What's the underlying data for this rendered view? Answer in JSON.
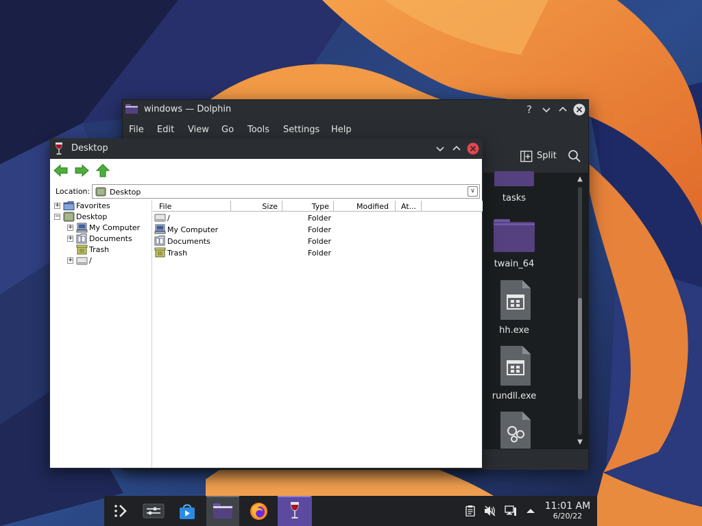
{
  "dolphin": {
    "title": "windows — Dolphin",
    "menu": [
      "File",
      "Edit",
      "View",
      "Go",
      "Tools",
      "Settings",
      "Help"
    ],
    "split_label": "Split",
    "files": [
      {
        "name": "tasks",
        "icon": "folder-icon"
      },
      {
        "name": "twain_64",
        "icon": "folder-icon"
      },
      {
        "name": "hh.exe",
        "icon": "executable-icon"
      },
      {
        "name": "rundll.exe",
        "icon": "executable-icon"
      },
      {
        "name": "",
        "icon": "settings-file-icon"
      }
    ]
  },
  "wine": {
    "title": "Desktop",
    "location_label": "Location:",
    "location_value": "Desktop",
    "tree": [
      {
        "label": "Favorites",
        "expander": "+",
        "icon": "favorites-folder-icon"
      },
      {
        "label": "Desktop",
        "expander": "−",
        "icon": "desktop-icon"
      },
      {
        "label": "My Computer",
        "expander": "+",
        "icon": "computer-icon"
      },
      {
        "label": "Documents",
        "expander": "+",
        "icon": "documents-icon"
      },
      {
        "label": "Trash",
        "expander": "",
        "icon": "trash-icon"
      },
      {
        "label": "/",
        "expander": "+",
        "icon": "drive-icon"
      }
    ],
    "columns": [
      "File",
      "Size",
      "Type",
      "Modified",
      "At..."
    ],
    "rows": [
      {
        "name": "/",
        "type": "Folder",
        "icon": "drive-icon"
      },
      {
        "name": "My Computer",
        "type": "Folder",
        "icon": "computer-icon"
      },
      {
        "name": "Documents",
        "type": "Folder",
        "icon": "documents-icon"
      },
      {
        "name": "Trash",
        "type": "Folder",
        "icon": "trash-icon"
      }
    ]
  },
  "taskbar": {
    "apps": [
      "app-launcher-icon",
      "system-settings-icon",
      "discover-store-icon",
      "dolphin-icon",
      "firefox-icon",
      "wine-icon"
    ],
    "tray": [
      "clipboard-icon",
      "volume-muted-icon",
      "network-icon",
      "tray-expand-icon"
    ],
    "time": "11:01 AM",
    "date": "6/20/22"
  },
  "colors": {
    "accent": "#5b4aa0",
    "close_button": "#e8454b",
    "folder_purple": "#55417f",
    "window_dark": "#2a2e32"
  }
}
